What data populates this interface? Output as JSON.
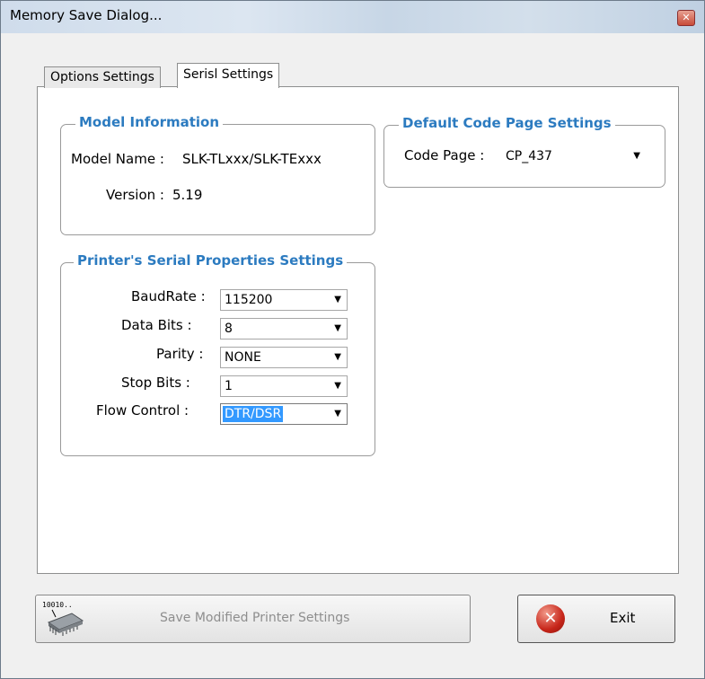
{
  "window": {
    "title": "Memory Save Dialog..."
  },
  "tabs": [
    {
      "label": "Options Settings"
    },
    {
      "label": "Serisl Settings"
    }
  ],
  "model_info": {
    "title": "Model Information",
    "model_name_label": "Model Name :",
    "model_name_value": "SLK-TLxxx/SLK-TExxx",
    "version_label": "Version :",
    "version_value": "5.19"
  },
  "code_page": {
    "title": "Default Code Page Settings",
    "label": "Code Page :",
    "value": "CP_437"
  },
  "serial": {
    "title": "Printer's Serial Properties Settings",
    "baudrate_label": "BaudRate :",
    "baudrate_value": "115200",
    "databits_label": "Data Bits :",
    "databits_value": "8",
    "parity_label": "Parity :",
    "parity_value": "NONE",
    "stopbits_label": "Stop Bits :",
    "stopbits_value": "1",
    "flow_label": "Flow Control :",
    "flow_value": "DTR/DSR"
  },
  "buttons": {
    "save_label": "Save Modified Printer Settings",
    "chip_text": "10010..",
    "exit_label": "Exit"
  },
  "colors": {
    "group_title": "#2c7bc0",
    "selection": "#3399ff"
  }
}
